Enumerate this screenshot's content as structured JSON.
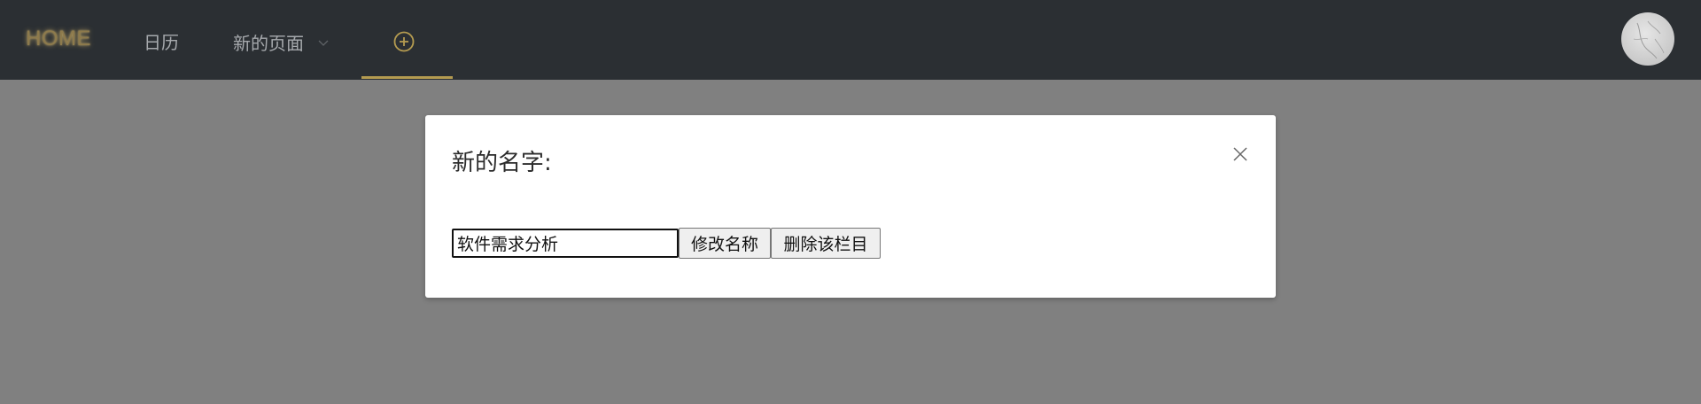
{
  "nav": {
    "home": "HOME",
    "calendar": "日历",
    "new_page": "新的页面",
    "add_icon": "plus-circle-icon",
    "dropdown_icon": "chevron-down-icon",
    "active_color": "#b49b50",
    "bg_color": "#2b2f33"
  },
  "modal": {
    "title": "新的名字:",
    "input_value": "软件需求分析",
    "rename_button": "修改名称",
    "delete_button": "删除该栏目",
    "close_icon": "close-icon"
  },
  "overlay_color": "#808080"
}
